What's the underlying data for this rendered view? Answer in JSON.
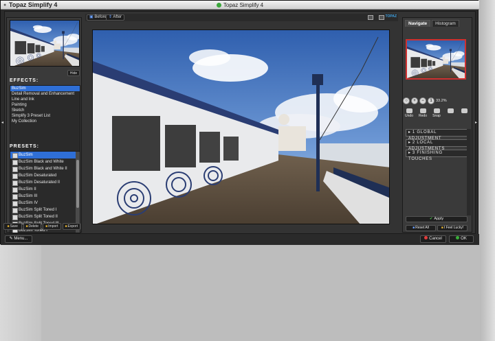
{
  "window": {
    "app_name": "Topaz Simplify 4",
    "title": "Topaz Simplify 4"
  },
  "preview_toolbar": {
    "before_label": "Before",
    "after_label": "After",
    "logo_text": "TOPAZ"
  },
  "left_panel": {
    "hide_label": "Hide",
    "effects_title": "EFFECTS:",
    "effects": [
      "BuzSim",
      "Detail Removal and Enhancement",
      "Line and Ink",
      "Painting",
      "Sketch",
      "Simplify 3 Preset List",
      "My Collection"
    ],
    "presets_title": "PRESETS:",
    "presets": [
      "BuzSim",
      "BuzSim Black and White",
      "BuzSim Black and White II",
      "BuzSim Desaturated",
      "BuzSim Desaturated II",
      "BuzSim II",
      "BuzSim III",
      "BuzSim IV",
      "BuzSim Split Toned I",
      "BuzSim Split Toned II",
      "BuzSim Split Toned III",
      "BuzSim Toned I"
    ],
    "preset_buttons": [
      "Save",
      "Delete",
      "Import",
      "Export"
    ]
  },
  "right_panel": {
    "tabs": [
      "Navigate",
      "Histogram"
    ],
    "zoom_value": "33.2%",
    "tools": [
      "Undo",
      "Redo",
      "Snap",
      "",
      ""
    ],
    "adjustments": [
      "1 GLOBAL ADJUSTMENT",
      "2 LOCAL ADJUSTMENTS",
      "3 FINISHING TOUCHES"
    ],
    "apply_label": "Apply",
    "reset_label": "Reset All",
    "lucky_label": "I Feel Lucky!"
  },
  "bottom_bar": {
    "menu_label": "Menu...",
    "cancel_label": "Cancel",
    "ok_label": "OK"
  },
  "colors": {
    "selection": "#2f6fd6",
    "panel_bg": "#3a3a3a",
    "nav_frame": "#d03030"
  }
}
